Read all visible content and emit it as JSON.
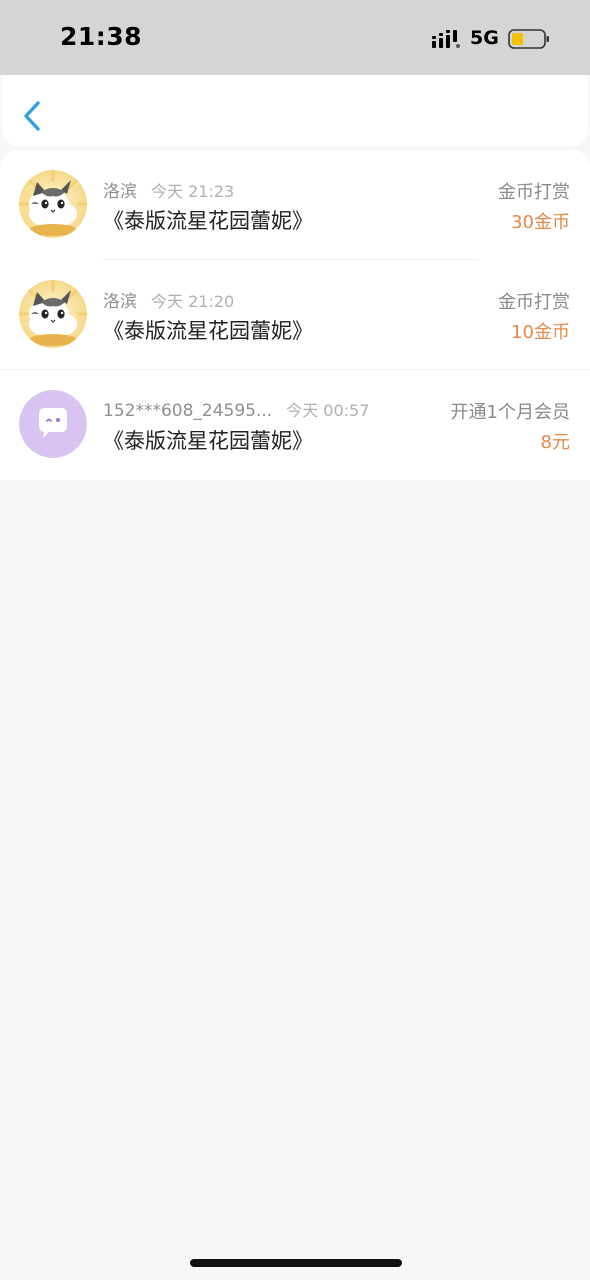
{
  "status_bar": {
    "time": "21:38",
    "network": "5G",
    "battery_color": "#f2c200"
  },
  "nav": {
    "back_icon": "chevron-left-icon",
    "accent_color": "#2f9fe0"
  },
  "records": [
    {
      "name": "洛滨",
      "time": "今天 21:23",
      "book": "《泰版流星花园蕾妮》",
      "type": "金币打赏",
      "amount": "30金币",
      "avatar": "cat-avatar"
    },
    {
      "name": "洛滨",
      "time": "今天 21:20",
      "book": "《泰版流星花园蕾妮》",
      "type": "金币打赏",
      "amount": "10金币",
      "avatar": "cat-avatar"
    },
    {
      "name": "152***608_24595...",
      "time": "今天 00:57",
      "book": "《泰版流星花园蕾妮》",
      "type": "开通1个月会员",
      "amount": "8元",
      "avatar": "default-chat-avatar"
    }
  ],
  "colors": {
    "amount": "#e4894a",
    "background": "#f7f7f7",
    "default_avatar": "#d9c3f2"
  }
}
